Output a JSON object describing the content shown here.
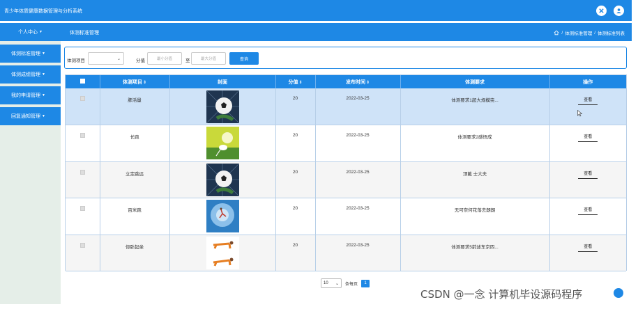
{
  "header": {
    "title": "青少年体质健康数据管理与分析系统",
    "icons": [
      "close-circle-icon",
      "user-icon"
    ]
  },
  "subbar": {
    "user_menu": "个人中心",
    "page_title": "体测标准管理",
    "breadcrumb": [
      "体测标准管理",
      "体测标准列表"
    ],
    "breadcrumb_sep": "/"
  },
  "sidebar": {
    "items": [
      {
        "label": "体测标准管理"
      },
      {
        "label": "体测成绩管理"
      },
      {
        "label": "我的申请管理"
      },
      {
        "label": "回复通知管理"
      }
    ]
  },
  "search": {
    "project_label": "体测项目",
    "project_value": "",
    "score_label": "分值",
    "min_placeholder": "最小分值",
    "to_label": "至",
    "max_placeholder": "最大分值",
    "query_button": "查询"
  },
  "table": {
    "columns": [
      "体测项目",
      "封面",
      "分值",
      "发布时间",
      "体测要求",
      "操作"
    ],
    "rows": [
      {
        "name": "肺活量",
        "cover": "soccer-ball-image",
        "score": "20",
        "date": "2022-03-25",
        "requirement": "体测要求1超大规模完...",
        "action": "查看"
      },
      {
        "name": "长跑",
        "cover": "badminton-image",
        "score": "20",
        "date": "2022-03-25",
        "requirement": "体测要求2感悟成",
        "action": "查看"
      },
      {
        "name": "立定跳远",
        "cover": "soccer-ball-image",
        "score": "20",
        "date": "2022-03-25",
        "requirement": "顶戴 士大夫",
        "action": "查看"
      },
      {
        "name": "百米跑",
        "cover": "jump-image",
        "score": "20",
        "date": "2022-03-25",
        "requirement": "无可奈何花落去朗朗",
        "action": "查看"
      },
      {
        "name": "仰卧起坐",
        "cover": "pushup-image",
        "score": "20",
        "date": "2022-03-25",
        "requirement": "体测要求5前述东京四...",
        "action": "查看"
      }
    ]
  },
  "pager": {
    "page_size": "10",
    "per_page_label": "条每页",
    "current_page": "1"
  },
  "watermark": "CSDN @一念 计算机毕设源码程序",
  "colors": {
    "primary": "#1e88e5",
    "sidebar_bg": "#e5eee8",
    "hover_row": "#cfe3f8"
  }
}
